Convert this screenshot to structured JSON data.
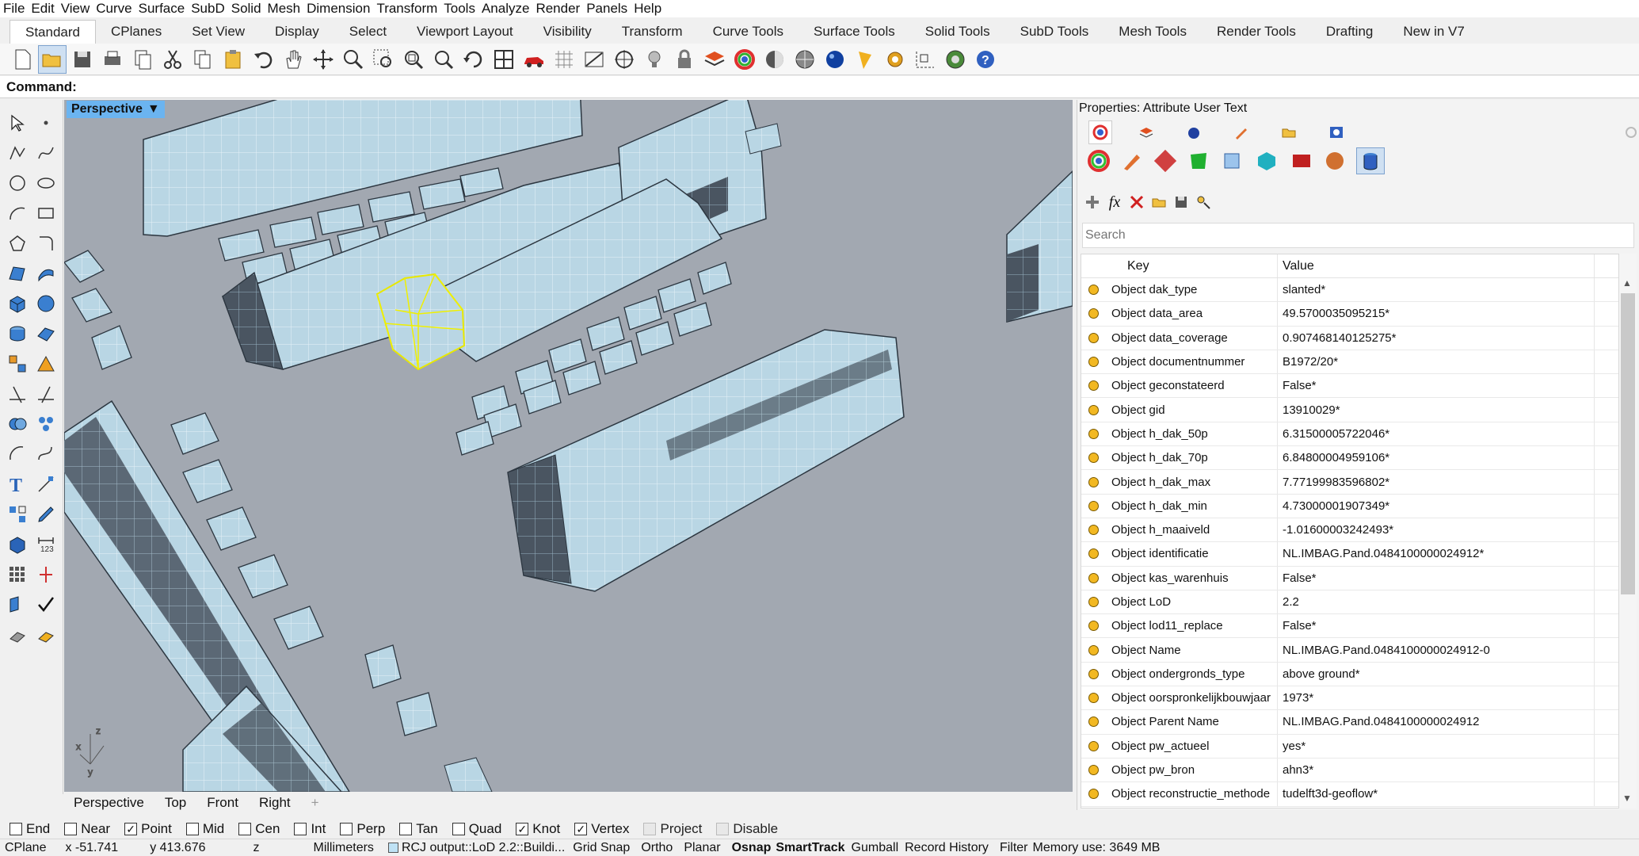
{
  "menu": [
    "File",
    "Edit",
    "View",
    "Curve",
    "Surface",
    "SubD",
    "Solid",
    "Mesh",
    "Dimension",
    "Transform",
    "Tools",
    "Analyze",
    "Render",
    "Panels",
    "Help"
  ],
  "tabs": [
    "Standard",
    "CPlanes",
    "Set View",
    "Display",
    "Select",
    "Viewport Layout",
    "Visibility",
    "Transform",
    "Curve Tools",
    "Surface Tools",
    "Solid Tools",
    "SubD Tools",
    "Mesh Tools",
    "Render Tools",
    "Drafting",
    "New in V7"
  ],
  "toolbar_icons": [
    "new-file-icon",
    "open-folder-icon",
    "save-icon",
    "print-icon",
    "copy-page-icon",
    "cut-icon",
    "copy-icon",
    "paste-icon",
    "undo-icon",
    "pan-hand-icon",
    "move-icon",
    "zoom-icon",
    "zoom-window-icon",
    "zoom-extents-icon",
    "zoom-selected-icon",
    "rotate-view-icon",
    "four-view-icon",
    "car-icon",
    "grid-icon",
    "grid-snap-icon",
    "snap-icon",
    "lightbulb-icon",
    "lock-icon",
    "layer-icon",
    "color-wheel-icon",
    "shade-sphere-icon",
    "material-sphere-icon",
    "render-sphere-icon",
    "spotlight-icon",
    "gear-icon",
    "dimension-icon",
    "globe-icon",
    "help-icon"
  ],
  "command": {
    "label": "Command:",
    "value": ""
  },
  "viewport": {
    "title": "Perspective",
    "tabs": [
      "Perspective",
      "Top",
      "Front",
      "Right"
    ]
  },
  "panel": {
    "title": "Properties: Attribute User Text",
    "search_placeholder": "Search",
    "headers": {
      "key": "Key",
      "value": "Value"
    },
    "rows": [
      {
        "key": "Object dak_type",
        "value": "slanted*"
      },
      {
        "key": "Object data_area",
        "value": "49.5700035095215*"
      },
      {
        "key": "Object data_coverage",
        "value": "0.907468140125275*"
      },
      {
        "key": "Object documentnummer",
        "value": "B1972/20*"
      },
      {
        "key": "Object geconstateerd",
        "value": "False*"
      },
      {
        "key": "Object gid",
        "value": "13910029*"
      },
      {
        "key": "Object h_dak_50p",
        "value": "6.31500005722046*"
      },
      {
        "key": "Object h_dak_70p",
        "value": "6.84800004959106*"
      },
      {
        "key": "Object h_dak_max",
        "value": "7.77199983596802*"
      },
      {
        "key": "Object h_dak_min",
        "value": "4.73000001907349*"
      },
      {
        "key": "Object h_maaiveld",
        "value": "-1.01600003242493*"
      },
      {
        "key": "Object identificatie",
        "value": "NL.IMBAG.Pand.0484100000024912*"
      },
      {
        "key": "Object kas_warenhuis",
        "value": "False*"
      },
      {
        "key": "Object LoD",
        "value": "2.2"
      },
      {
        "key": "Object lod11_replace",
        "value": "False*"
      },
      {
        "key": "Object Name",
        "value": "NL.IMBAG.Pand.0484100000024912-0"
      },
      {
        "key": "Object ondergronds_type",
        "value": "above ground*"
      },
      {
        "key": "Object oorspronkelijkbouwjaar",
        "value": "1973*"
      },
      {
        "key": "Object Parent Name",
        "value": "NL.IMBAG.Pand.0484100000024912"
      },
      {
        "key": "Object pw_actueel",
        "value": "yes*"
      },
      {
        "key": "Object pw_bron",
        "value": "ahn3*"
      },
      {
        "key": "Object reconstructie_methode",
        "value": "tudelft3d-geoflow*"
      }
    ]
  },
  "osnaps": [
    {
      "label": "End",
      "checked": false
    },
    {
      "label": "Near",
      "checked": false
    },
    {
      "label": "Point",
      "checked": true
    },
    {
      "label": "Mid",
      "checked": false
    },
    {
      "label": "Cen",
      "checked": false
    },
    {
      "label": "Int",
      "checked": false
    },
    {
      "label": "Perp",
      "checked": false
    },
    {
      "label": "Tan",
      "checked": false
    },
    {
      "label": "Quad",
      "checked": false
    },
    {
      "label": "Knot",
      "checked": true
    },
    {
      "label": "Vertex",
      "checked": true
    },
    {
      "label": "Project",
      "checked": false,
      "disabled": true
    },
    {
      "label": "Disable",
      "checked": false,
      "disabled": true
    }
  ],
  "status": {
    "cplane": "CPlane",
    "x": "x -51.741",
    "y": "y 413.676",
    "z": "z",
    "units": "Millimeters",
    "layer": "RCJ output::LoD 2.2::Buildi...",
    "grid_snap": "Grid Snap",
    "ortho": "Ortho",
    "planar": "Planar",
    "osnap": "Osnap",
    "smarttrack": "SmartTrack",
    "gumball": "Gumball",
    "record_history": "Record History",
    "filter": "Filter",
    "memory": "Memory use: 3649 MB"
  }
}
